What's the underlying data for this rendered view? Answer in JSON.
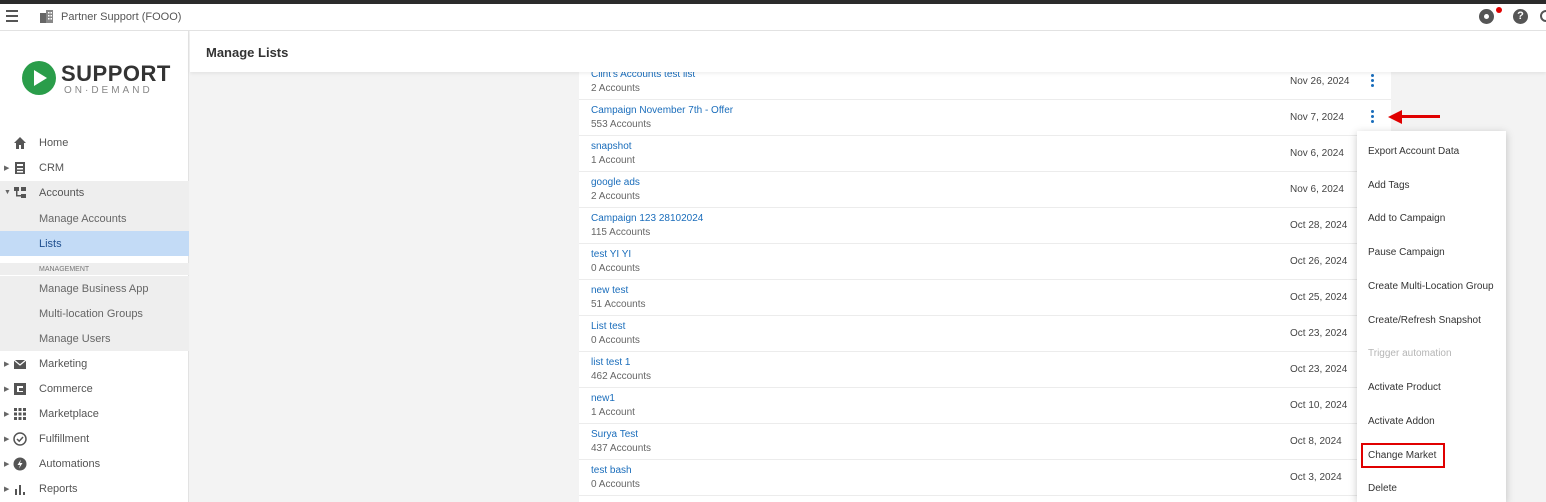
{
  "topbar": {
    "partner_name": "Partner Support (FOOO)",
    "help_glyph": "?"
  },
  "logo": {
    "main": "SUPPORT",
    "sub": "ON·DEMAND"
  },
  "sidebar": {
    "items": [
      {
        "label": "Home",
        "icon": "home-icon"
      },
      {
        "label": "CRM",
        "icon": "crm-icon"
      },
      {
        "label": "Accounts",
        "icon": "accounts-icon"
      }
    ],
    "accounts_sub": [
      {
        "label": "Manage Accounts"
      },
      {
        "label": "Lists",
        "active": true
      }
    ],
    "management_heading": "MANAGEMENT",
    "management_sub": [
      {
        "label": "Manage Business App"
      },
      {
        "label": "Multi-location Groups"
      },
      {
        "label": "Manage Users"
      }
    ],
    "bottom_items": [
      {
        "label": "Marketing",
        "icon": "mail-icon"
      },
      {
        "label": "Commerce",
        "icon": "commerce-icon"
      },
      {
        "label": "Marketplace",
        "icon": "grid-icon"
      },
      {
        "label": "Fulfillment",
        "icon": "check-circle-icon"
      },
      {
        "label": "Automations",
        "icon": "bolt-icon"
      },
      {
        "label": "Reports",
        "icon": "bar-chart-icon"
      }
    ]
  },
  "main": {
    "title": "Manage Lists"
  },
  "lists": [
    {
      "name": "Clint's Accounts test list",
      "count": "2 Accounts",
      "date": "Nov 26, 2024"
    },
    {
      "name": "Campaign November 7th - Offer",
      "count": "553 Accounts",
      "date": "Nov 7, 2024"
    },
    {
      "name": "snapshot",
      "count": "1 Account",
      "date": "Nov 6, 2024"
    },
    {
      "name": "google ads",
      "count": "2 Accounts",
      "date": "Nov 6, 2024"
    },
    {
      "name": "Campaign 123 28102024",
      "count": "115 Accounts",
      "date": "Oct 28, 2024"
    },
    {
      "name": "test YI YI",
      "count": "0 Accounts",
      "date": "Oct 26, 2024"
    },
    {
      "name": "new test",
      "count": "51 Accounts",
      "date": "Oct 25, 2024"
    },
    {
      "name": "List test",
      "count": "0 Accounts",
      "date": "Oct 23, 2024"
    },
    {
      "name": "list test 1",
      "count": "462 Accounts",
      "date": "Oct 23, 2024"
    },
    {
      "name": "new1",
      "count": "1 Account",
      "date": "Oct 10, 2024"
    },
    {
      "name": "Surya Test",
      "count": "437 Accounts",
      "date": "Oct 8, 2024"
    },
    {
      "name": "test bash",
      "count": "0 Accounts",
      "date": "Oct 3, 2024"
    }
  ],
  "context_menu": [
    {
      "label": "Export Account Data"
    },
    {
      "label": "Add Tags"
    },
    {
      "label": "Add to Campaign"
    },
    {
      "label": "Pause Campaign"
    },
    {
      "label": "Create Multi-Location Group"
    },
    {
      "label": "Create/Refresh Snapshot"
    },
    {
      "label": "Trigger automation",
      "disabled": true
    },
    {
      "label": "Activate Product"
    },
    {
      "label": "Activate Addon"
    },
    {
      "label": "Change Market",
      "highlighted": true
    },
    {
      "label": "Delete"
    }
  ],
  "colors": {
    "link": "#1a6dbb",
    "active_nav": "#c3dbf6",
    "annotation_red": "#e00000",
    "brand_green": "#2a9d4a"
  }
}
